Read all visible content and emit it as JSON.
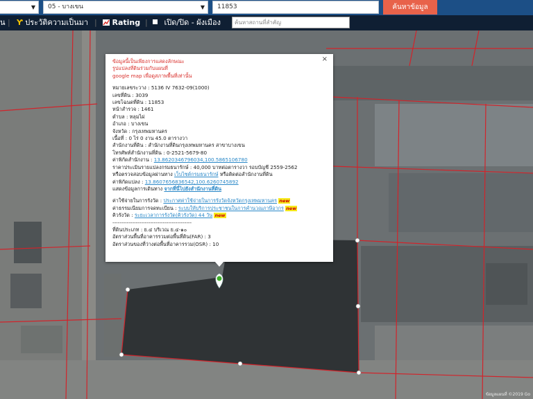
{
  "topbar": {
    "province_select": "",
    "district_select": "05 - บางเขน",
    "parcel_number_value": "11853",
    "search_button_label": "ค้นหาข้อมูล"
  },
  "toolbar": {
    "left_cut_label": "น",
    "history_label": "ประวัติความเป็นมา",
    "rating_label": "Rating",
    "toggle_label": "เปิด/ปิด - ผังเมือง",
    "place_search_placeholder": "ค้นหาสถานที่สำคัญ"
  },
  "popup": {
    "warning_lines": [
      "ข้อมูลนี้เป็นเพียงการแสดงลักษณะ",
      "รูปแปลงที่ดินร่วมกับแผนที่",
      "google map เพื่อดูสภาพพื้นที่เท่านั้น"
    ],
    "close_label": "×",
    "fields": [
      {
        "label": "หมายเลขระวาง",
        "value": "5136 IV 7632-09(1000)"
      },
      {
        "label": "เลขที่ดิน",
        "value": "3039"
      },
      {
        "label": "เลขโฉนดที่ดิน",
        "value": "11853"
      },
      {
        "label": "หน้าสำรวจ",
        "value": "1461"
      },
      {
        "label": "ตำบล",
        "value": "หลุมไผ่"
      },
      {
        "label": "อำเภอ",
        "value": "บางเขน"
      },
      {
        "label": "จังหวัด",
        "value": "กรุงเทพมหานคร"
      },
      {
        "label": "เนื้อที่",
        "value": "0 ไร่ 0 งาน 45.0 ตารางวา"
      },
      {
        "label": "สำนักงานที่ดิน",
        "value": "สำนักงานที่ดินกรุงเทพมหานคร สาขาบางเขน"
      },
      {
        "label": "โทรศัพท์สำนักงานที่ดิน",
        "value": "0-2521-5679-80"
      }
    ],
    "office_coord_label": "ค่าพิกัดสำนักงาน",
    "office_coord_value": "13.8620346796034,100.5865106780",
    "price_label": "ราคาประเมินรายแปลงกรมธนารักษ์",
    "price_value": "40,000 บาทต่อตารางวา รอบบัญชี 2559-2562",
    "check_prefix": "หรือตรวจสอบข้อมูลผ่านทาง",
    "check_link": "เว็บไซต์กรมธนารักษ์",
    "check_suffix": "หรือติดต่อสำนักงานที่ดิน",
    "parcel_coord_label": "ค่าพิกัดแปลง",
    "parcel_coord_value": "13.8607656836542,100.6260745892",
    "route_label": "แสดงข้อมูลการเดินทาง",
    "route_link": "จากที่นี่ไปยังสำนักงานที่ดิน",
    "links": [
      {
        "label": "ค่าใช้จ่ายในการรังวัด",
        "value": "ประกาศค่าใช้จ่ายในการรังวัดจังหวัดกรุงเทพมหานคร",
        "badge": "new"
      },
      {
        "label": "ค่าธรรมเนียมการจดทะเบียน",
        "value": "ระบบให้บริการประชาชนในการคำนวณภาษีอากร",
        "badge": "new"
      },
      {
        "label": "คิวรังวัด",
        "value": "ระยะเวลาการรังวัด(คิวรังวัด) 44 วัน",
        "badge": "new"
      }
    ],
    "divider": "--------------------------------------------",
    "zoning": [
      {
        "label": "ที่ดินประเภท",
        "value": "ย.๔ บริเวณ ย.๔-๑๐"
      },
      {
        "label": "อัตราส่วนพื้นที่อาคารรวมต่อพื้นที่ดิน(FAR)",
        "value": "3"
      },
      {
        "label": "อัตราส่วนของที่ว่างต่อพื้นที่อาคารรวม(OSR)",
        "value": "10"
      }
    ]
  },
  "map": {
    "copyright": "ข้อมูลแผนที่ ©2019 Go",
    "parcel_fill": "#2f3335",
    "boundary_color": "#d2232a"
  }
}
